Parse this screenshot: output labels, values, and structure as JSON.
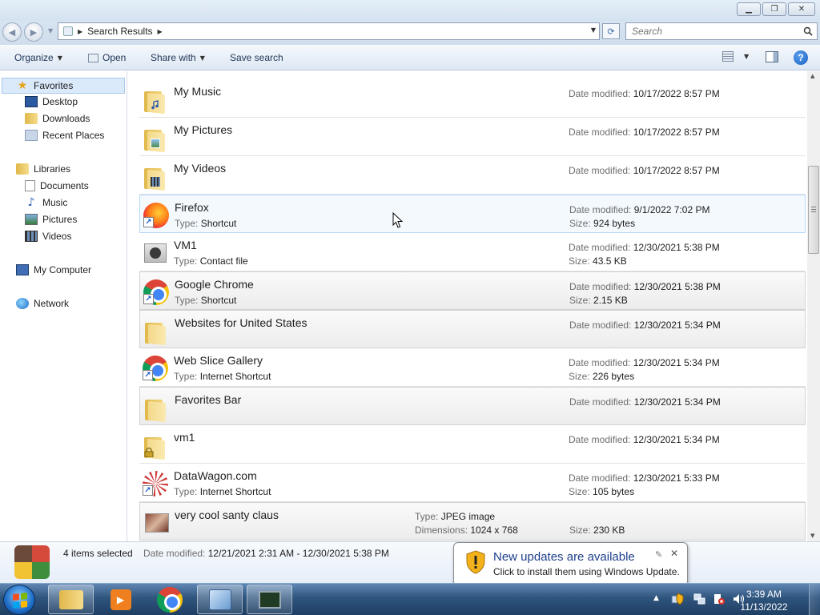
{
  "window": {
    "minimize_icon": "minimize-icon",
    "restore_icon": "restore-icon",
    "close_icon": "close-icon"
  },
  "address": {
    "back_icon": "back-arrow-icon",
    "forward_icon": "forward-arrow-icon",
    "location": "Search Results",
    "search_placeholder": "Search"
  },
  "toolbar": {
    "organize": "Organize",
    "open": "Open",
    "share_with": "Share with",
    "save_search": "Save search"
  },
  "sidebar": {
    "favorites": "Favorites",
    "favorites_items": [
      "Desktop",
      "Downloads",
      "Recent Places"
    ],
    "libraries": "Libraries",
    "libraries_items": [
      "Documents",
      "Music",
      "Pictures",
      "Videos"
    ],
    "computer": "My Computer",
    "network": "Network"
  },
  "labels": {
    "date_modified": "Date modified:",
    "type": "Type:",
    "size": "Size:",
    "dimensions": "Dimensions:"
  },
  "files": [
    {
      "name": "My Music",
      "date": "10/17/2022 8:57 PM",
      "icon": "music-folder-icon"
    },
    {
      "name": "My Pictures",
      "date": "10/17/2022 8:57 PM",
      "icon": "pictures-folder-icon"
    },
    {
      "name": "My Videos",
      "date": "10/17/2022 8:57 PM",
      "icon": "videos-folder-icon"
    },
    {
      "name": "Firefox",
      "type": "Shortcut",
      "date": "9/1/2022 7:02 PM",
      "size": "924 bytes",
      "icon": "firefox-shortcut-icon"
    },
    {
      "name": "VM1",
      "type": "Contact file",
      "date": "12/30/2021 5:38 PM",
      "size": "43.5 KB",
      "icon": "contact-file-icon"
    },
    {
      "name": "Google Chrome",
      "type": "Shortcut",
      "date": "12/30/2021 5:38 PM",
      "size": "2.15 KB",
      "icon": "chrome-shortcut-icon"
    },
    {
      "name": "Websites for United States",
      "date": "12/30/2021 5:34 PM",
      "icon": "folder-icon"
    },
    {
      "name": "Web Slice Gallery",
      "type": "Internet Shortcut",
      "date": "12/30/2021 5:34 PM",
      "size": "226 bytes",
      "icon": "chrome-shortcut-icon"
    },
    {
      "name": "Favorites Bar",
      "date": "12/30/2021 5:34 PM",
      "icon": "folder-icon"
    },
    {
      "name": "vm1",
      "date": "12/30/2021 5:34 PM",
      "icon": "locked-folder-icon"
    },
    {
      "name": "DataWagon.com",
      "type": "Internet Shortcut",
      "date": "12/30/2021 5:33 PM",
      "size": "105 bytes",
      "icon": "datawagon-shortcut-icon"
    },
    {
      "name": "very cool santy claus",
      "type": "JPEG image",
      "dimensions": "1024 x 768",
      "size": "230 KB",
      "icon": "jpeg-thumbnail-icon"
    }
  ],
  "details": {
    "count": "4 items selected",
    "date_label": "Date modified:",
    "date_range": "12/21/2021 2:31 AM - 12/30/2021 5:38 PM"
  },
  "notification": {
    "title": "New updates are available",
    "text": "Click to install them using Windows Update."
  },
  "clock": {
    "time": "3:39 AM",
    "date": "11/13/2022"
  },
  "colors": {
    "accent": "#1e3f8a",
    "selection": "#dbeafb",
    "taskbar": "#2f557e"
  }
}
